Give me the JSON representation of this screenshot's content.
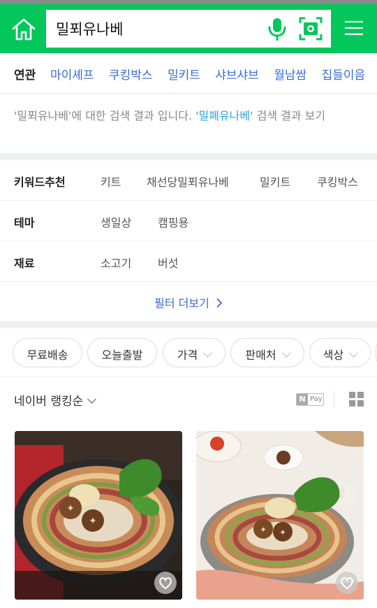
{
  "search": {
    "query": "밀푀유나베"
  },
  "icons": {
    "home": "home-icon",
    "mic": "microphone-icon",
    "lens": "camera-search-icon",
    "menu": "hamburger-menu-icon",
    "grid": "grid-view-icon",
    "heart": "heart-icon",
    "chevron": "chevron-down-icon",
    "more_arrow": "chevron-right-icon"
  },
  "colors": {
    "brand_green": "#03c75a",
    "link_blue": "#3b6bd1",
    "highlight_cyan": "#2fa6d4"
  },
  "related": {
    "label": "연관",
    "items": [
      "마이셰프",
      "쿠킹박스",
      "밀키트",
      "샤브샤브",
      "월남쌈",
      "집들이음"
    ]
  },
  "notice": {
    "part1": "'밀푀유나베'에 대한 검색 결과 입니다. ",
    "suggestion": "'밀폐유나베'",
    "part2": " 검색 결과 보기"
  },
  "filters": {
    "keyword": {
      "title": "키워드추천",
      "options": [
        "키트",
        "채선당밀푀유나베",
        "밀키트",
        "쿠킹박스"
      ]
    },
    "theme": {
      "title": "테마",
      "options": [
        "생일상",
        "캠핑용"
      ]
    },
    "ingredient": {
      "title": "재료",
      "options": [
        "소고기",
        "버섯"
      ]
    },
    "more_label": "필터 더보기"
  },
  "chips": [
    {
      "label": "무료배송"
    },
    {
      "label": "오늘출발"
    },
    {
      "label": "가격"
    },
    {
      "label": "판매처"
    },
    {
      "label": "색상"
    }
  ],
  "sort": {
    "label": "네이버 랭킹순",
    "npay_n": "N",
    "npay_label": "Pay"
  }
}
